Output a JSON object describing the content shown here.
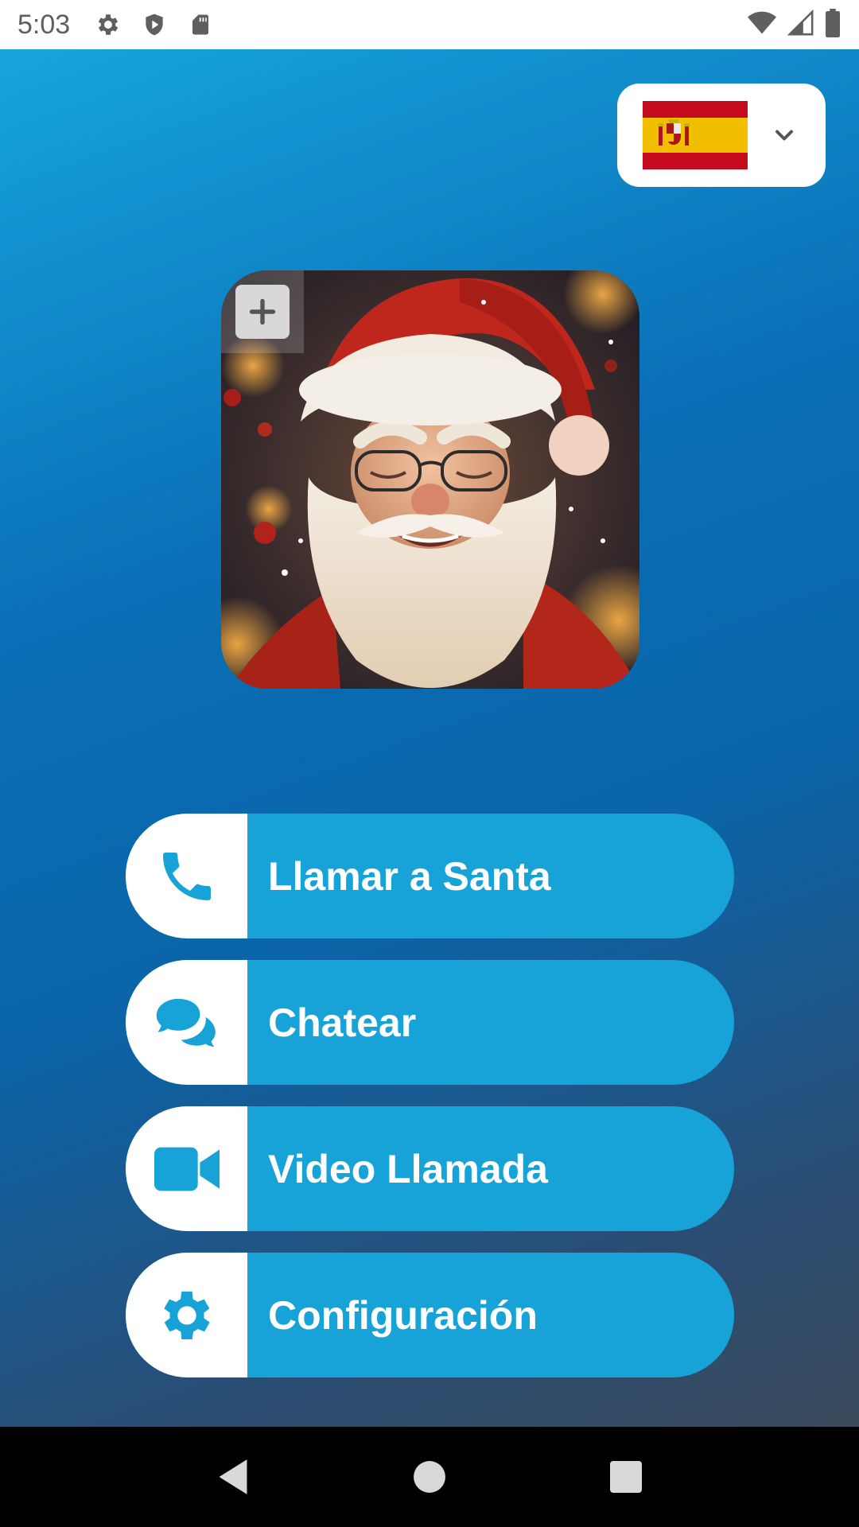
{
  "status_bar": {
    "time": "5:03",
    "left_icons": [
      "settings-icon",
      "shield-play-icon",
      "sd-card-icon"
    ],
    "right_icons": [
      "wifi-icon",
      "signal-icon",
      "battery-icon"
    ]
  },
  "language": {
    "selected_flag": "spain-flag",
    "colors": {
      "red": "#c60b1e",
      "yellow": "#f1bf00"
    }
  },
  "avatar": {
    "subject": "Santa Claus portrait",
    "add_icon": "plus-icon"
  },
  "actions": [
    {
      "id": "call",
      "label": "Llamar a Santa",
      "icon": "phone-icon"
    },
    {
      "id": "chat",
      "label": "Chatear",
      "icon": "chat-bubbles-icon"
    },
    {
      "id": "video",
      "label": "Video Llamada",
      "icon": "video-camera-icon"
    },
    {
      "id": "settings",
      "label": "Configuración",
      "icon": "gear-icon"
    }
  ],
  "theme": {
    "accent": "#17a3d8",
    "icon_color": "#17a3d8",
    "background_top": "#16a4dc",
    "background_bottom": "#3a4a5c"
  },
  "nav_bar": {
    "buttons": [
      "back-icon",
      "home-icon",
      "recents-icon"
    ]
  }
}
